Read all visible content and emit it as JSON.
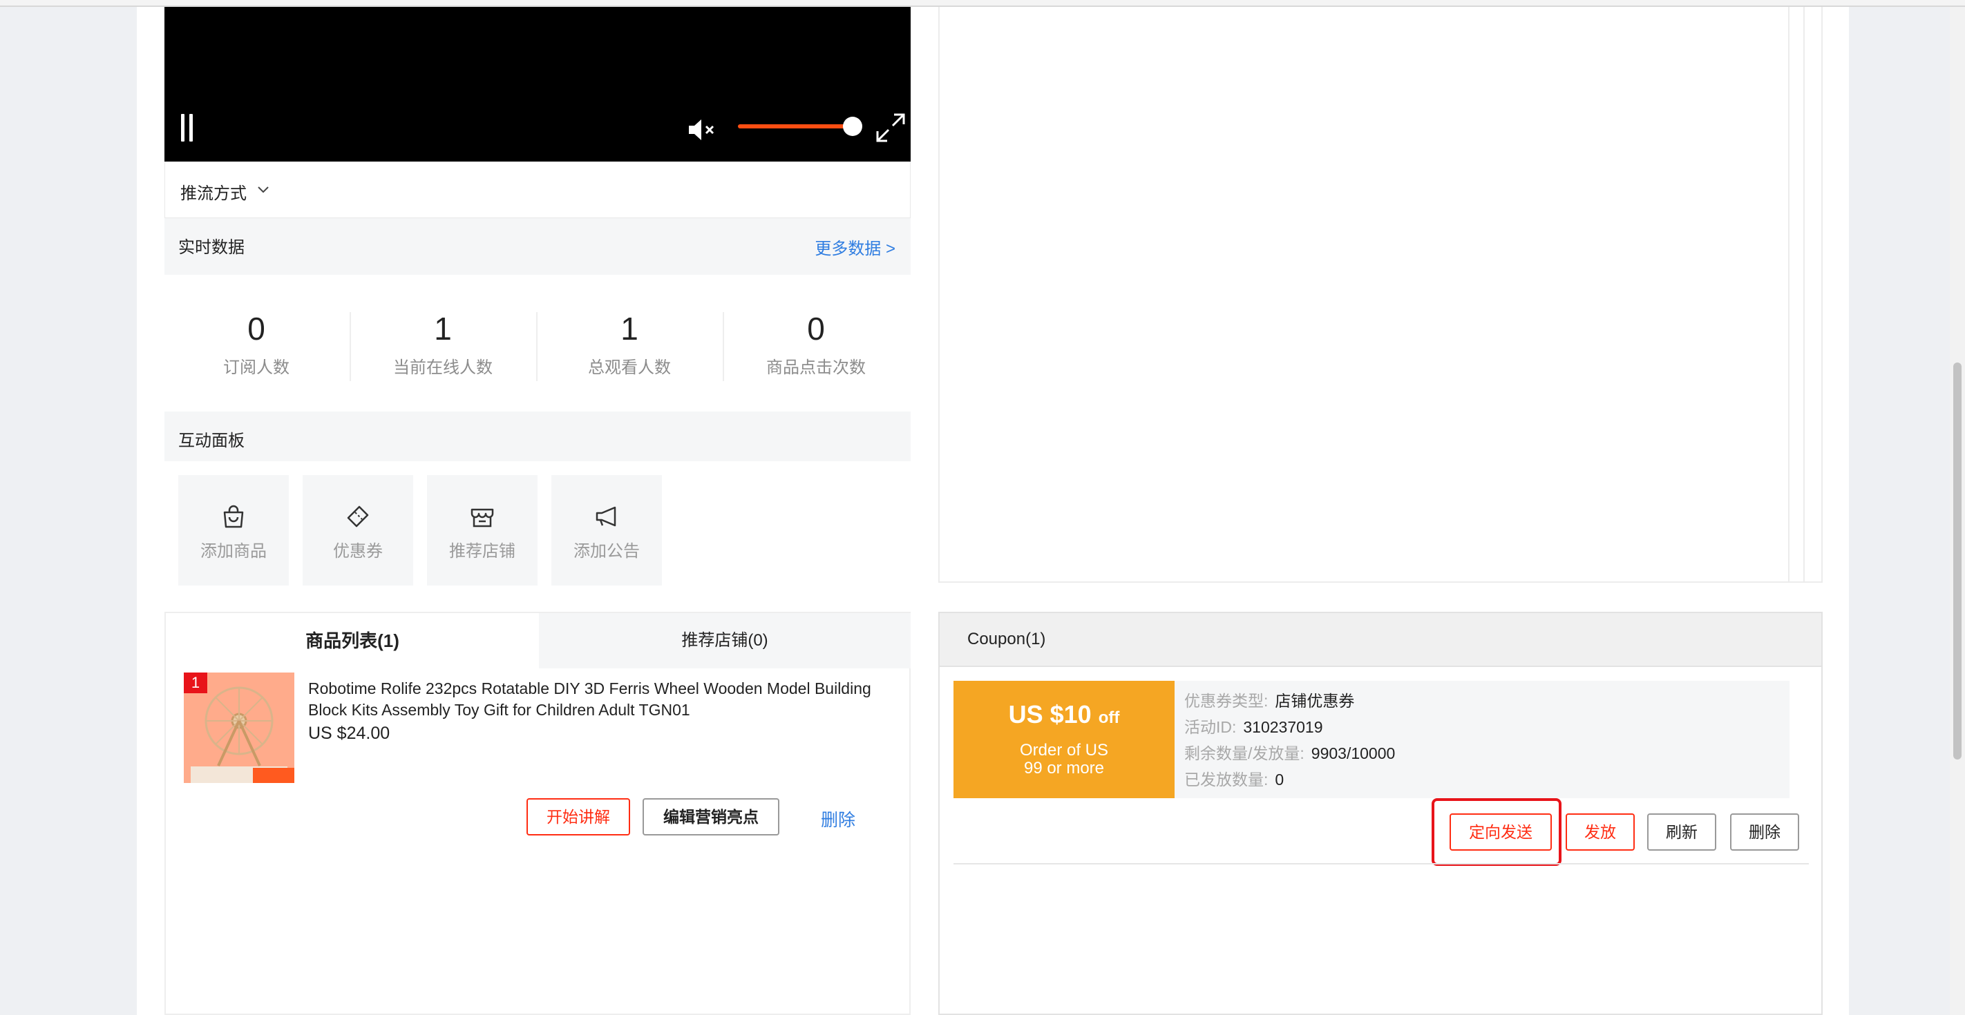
{
  "colors": {
    "accent": "#ff2d13",
    "link": "#2f7de1",
    "coupon_bg": "#f5a623",
    "volume": "#ff4e12"
  },
  "video": {
    "icons": [
      "pause-icon",
      "mute-icon",
      "fullscreen-icon"
    ],
    "volume_level": 1.0
  },
  "push": {
    "label": "推流方式"
  },
  "realtime": {
    "title": "实时数据",
    "more_link": "更多数据 >",
    "stats": [
      {
        "value": "0",
        "label": "订阅人数"
      },
      {
        "value": "1",
        "label": "当前在线人数"
      },
      {
        "value": "1",
        "label": "总观看人数"
      },
      {
        "value": "0",
        "label": "商品点击次数"
      }
    ]
  },
  "interaction": {
    "title": "互动面板",
    "tiles": [
      {
        "label": "添加商品",
        "icon": "shopping-bag-icon"
      },
      {
        "label": "优惠券",
        "icon": "ticket-icon"
      },
      {
        "label": "推荐店铺",
        "icon": "store-icon"
      },
      {
        "label": "添加公告",
        "icon": "megaphone-icon"
      }
    ]
  },
  "product_panel": {
    "tabs": [
      {
        "label": "商品列表(1)"
      },
      {
        "label": "推荐店铺(0)"
      }
    ],
    "product": {
      "rank": "1",
      "title": "Robotime Rolife 232pcs Rotatable DIY 3D Ferris Wheel Wooden Model Building Block Kits Assembly Toy Gift for Children Adult TGN01",
      "price": "US $24.00"
    },
    "actions": {
      "start": "开始讲解",
      "edit": "编辑营销亮点",
      "delete": "删除"
    }
  },
  "coupon_panel": {
    "title": "Coupon(1)",
    "card": {
      "amount": "US $10",
      "off": "off",
      "condition_line1": "Order of US",
      "condition_line2": "99 or more"
    },
    "info": [
      {
        "key": "优惠券类型:",
        "value": "店铺优惠券"
      },
      {
        "key": "活动ID:",
        "value": "310237019"
      },
      {
        "key": "剩余数量/发放量:",
        "value": "9903/10000"
      },
      {
        "key": "已发放数量:",
        "value": "0"
      }
    ],
    "actions": {
      "targeted_send": "定向发送",
      "issue": "发放",
      "refresh": "刷新",
      "delete": "删除"
    }
  }
}
